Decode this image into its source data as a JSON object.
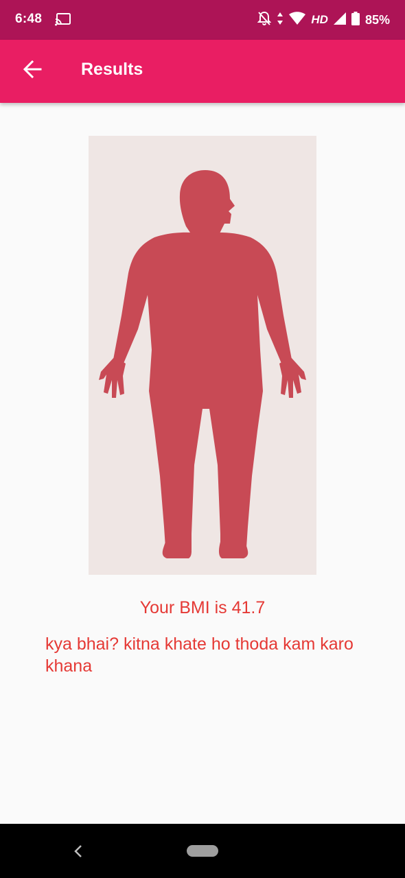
{
  "status_bar": {
    "time": "6:48",
    "network": "HD",
    "battery": "85%",
    "icons": [
      "cast-icon",
      "bell-off-icon",
      "data-arrows-icon",
      "wifi-icon",
      "signal-icon",
      "battery-icon"
    ]
  },
  "app_bar": {
    "title": "Results",
    "back_icon": "arrow-back-icon"
  },
  "result": {
    "bmi_text": "Your BMI is 41.7",
    "message": "kya bhai? kitna khate ho thoda kam karo khana"
  },
  "nav_bar": {
    "icons": [
      "nav-back-icon",
      "nav-home-pill"
    ]
  },
  "colors": {
    "status_bar": "#ad1456",
    "app_bar": "#e91e63",
    "text_accent": "#e53935",
    "figure": "#c84a55",
    "image_background": "#efe6e4"
  }
}
